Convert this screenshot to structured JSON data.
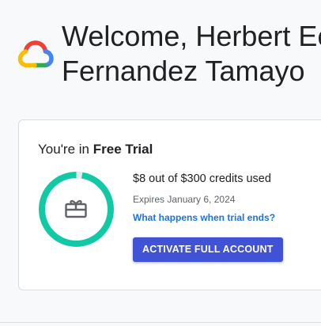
{
  "header": {
    "welcome_line1": "Welcome, Herbert Ec",
    "welcome_line2": "Fernandez Tamayo"
  },
  "trial_card": {
    "title_prefix": "You're in ",
    "title_emphasis": "Free Trial",
    "credits_text": "$8 out of $300 credits used",
    "credits_used": 8,
    "credits_total": 300,
    "expires_text": "Expires January 6, 2024",
    "link_label": "What happens when trial ends?",
    "activate_label": "ACTIVATE FULL ACCOUNT",
    "gift_icon": "gift-card-icon"
  },
  "colors": {
    "ring_remaining": "#12c9a6",
    "ring_used": "#e8eaed",
    "link": "#1a73e8",
    "button": "#4052d6"
  }
}
